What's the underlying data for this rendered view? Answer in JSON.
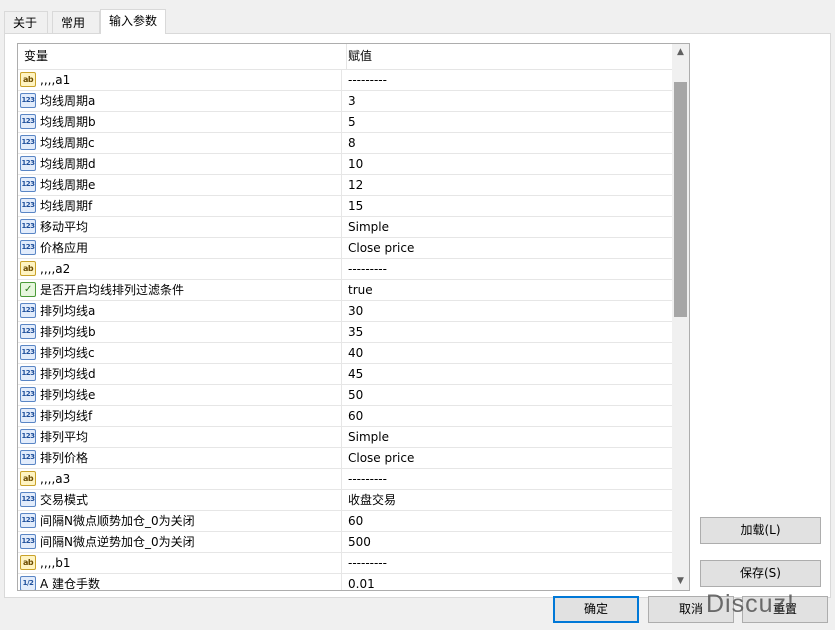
{
  "tabs": [
    {
      "label": "关于"
    },
    {
      "label": "常用"
    },
    {
      "label": "输入参数"
    }
  ],
  "grid": {
    "headers": {
      "variable": "变量",
      "value": "赋值"
    },
    "rows": [
      {
        "icon": "ab",
        "name": ",,,,a1",
        "value": "---------"
      },
      {
        "icon": "123",
        "name": "均线周期a",
        "value": "3"
      },
      {
        "icon": "123",
        "name": "均线周期b",
        "value": "5"
      },
      {
        "icon": "123",
        "name": "均线周期c",
        "value": "8"
      },
      {
        "icon": "123",
        "name": "均线周期d",
        "value": "10"
      },
      {
        "icon": "123",
        "name": "均线周期e",
        "value": "12"
      },
      {
        "icon": "123",
        "name": "均线周期f",
        "value": "15"
      },
      {
        "icon": "123",
        "name": "移动平均",
        "value": "Simple"
      },
      {
        "icon": "123",
        "name": "价格应用",
        "value": "Close price"
      },
      {
        "icon": "ab",
        "name": ",,,,a2",
        "value": "---------"
      },
      {
        "icon": "bool",
        "name": "是否开启均线排列过滤条件",
        "value": "true"
      },
      {
        "icon": "123",
        "name": "排列均线a",
        "value": "30"
      },
      {
        "icon": "123",
        "name": "排列均线b",
        "value": "35"
      },
      {
        "icon": "123",
        "name": "排列均线c",
        "value": "40"
      },
      {
        "icon": "123",
        "name": "排列均线d",
        "value": "45"
      },
      {
        "icon": "123",
        "name": "排列均线e",
        "value": "50"
      },
      {
        "icon": "123",
        "name": "排列均线f",
        "value": "60"
      },
      {
        "icon": "123",
        "name": "排列平均",
        "value": "Simple"
      },
      {
        "icon": "123",
        "name": "排列价格",
        "value": "Close price"
      },
      {
        "icon": "ab",
        "name": ",,,,a3",
        "value": "---------"
      },
      {
        "icon": "123",
        "name": "交易模式",
        "value": "收盘交易"
      },
      {
        "icon": "123",
        "name": "间隔N微点顺势加仓_0为关闭",
        "value": "60"
      },
      {
        "icon": "123",
        "name": "间隔N微点逆势加仓_0为关闭",
        "value": "500"
      },
      {
        "icon": "ab",
        "name": ",,,,b1",
        "value": "---------"
      },
      {
        "icon": "1/2",
        "name": "A  建仓手数",
        "value": "0.01"
      }
    ]
  },
  "buttons": {
    "load": "加载(L)",
    "save": "保存(S)",
    "ok": "确定",
    "cancel": "取消",
    "reset": "重置"
  },
  "watermark": "Discuz!"
}
